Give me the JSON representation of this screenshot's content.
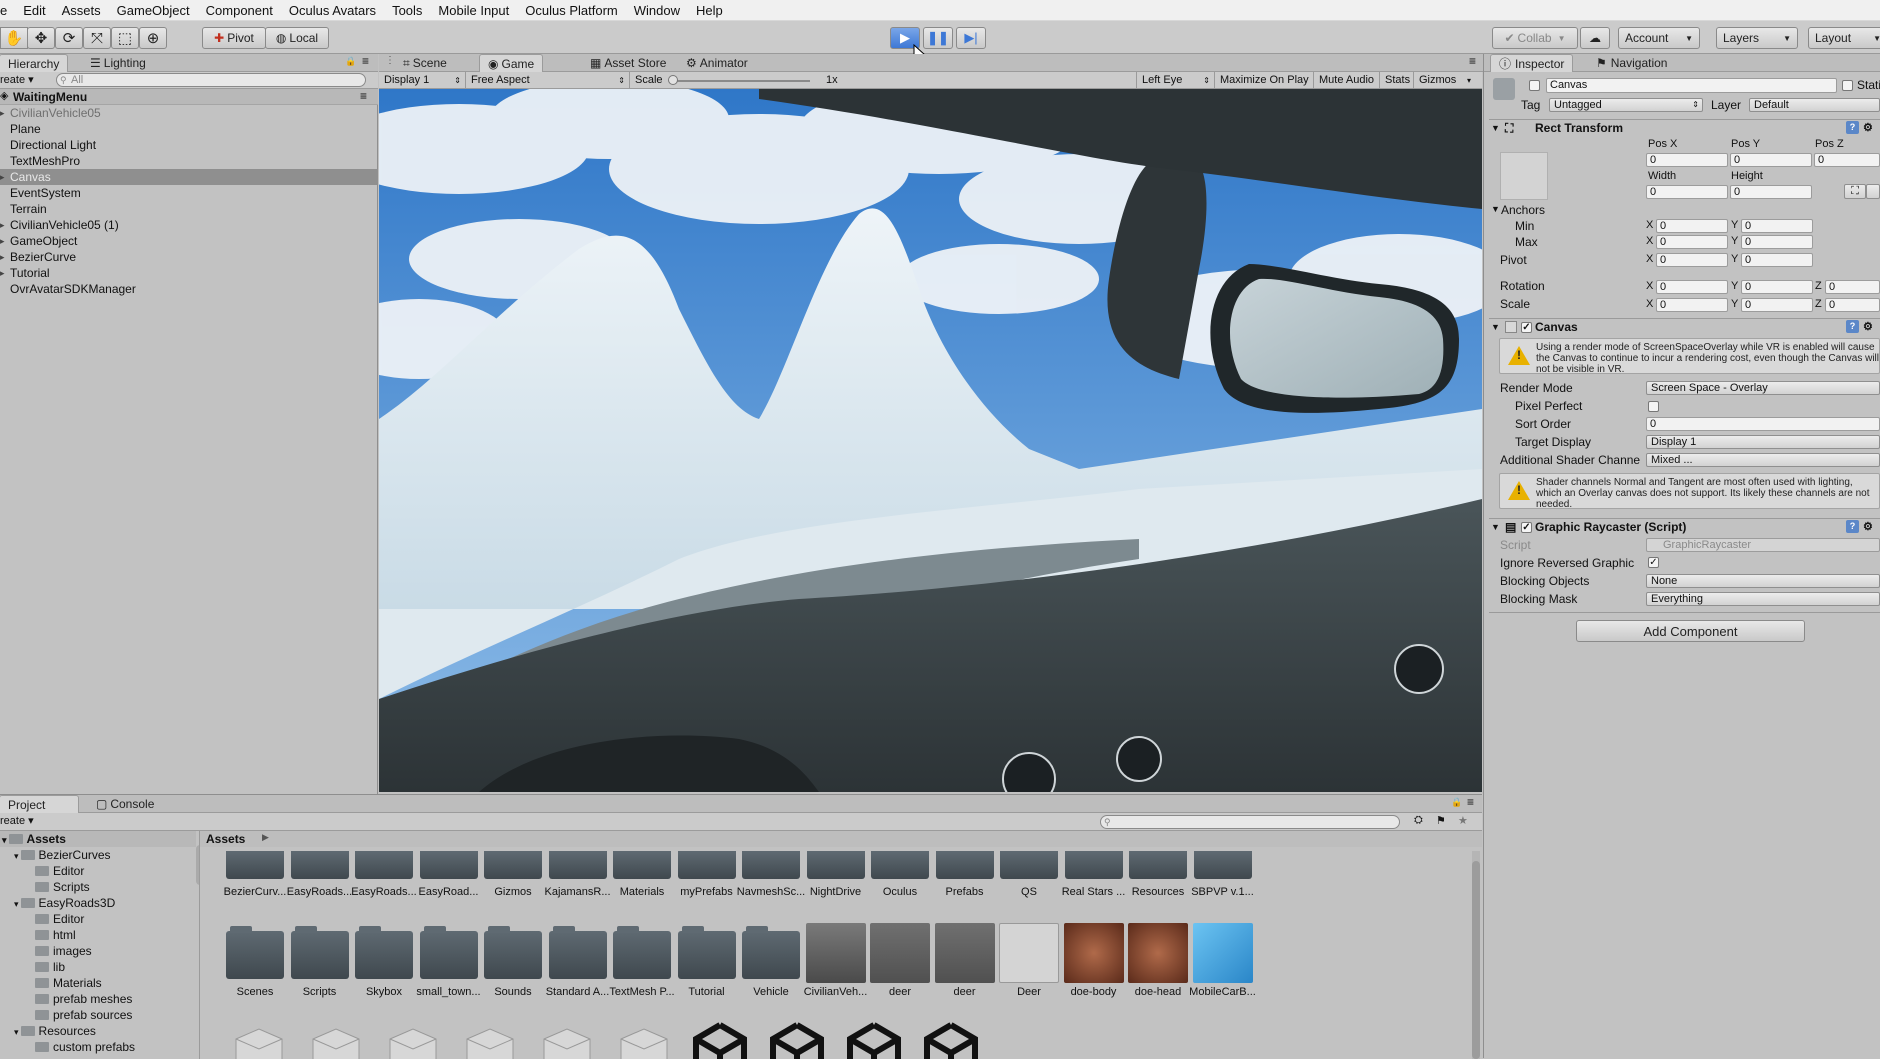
{
  "menu": [
    "e",
    "Edit",
    "Assets",
    "GameObject",
    "Component",
    "Oculus Avatars",
    "Tools",
    "Mobile Input",
    "Oculus Platform",
    "Window",
    "Help"
  ],
  "toolbar": {
    "pivot_label": "Pivot",
    "local_label": "Local",
    "collab_label": "Collab",
    "account_label": "Account",
    "layers_label": "Layers",
    "layout_label": "Layout",
    "play_state": "playing"
  },
  "hierarchy": {
    "tab_label": "Hierarchy",
    "lighting_tab_label": "Lighting",
    "create_label": "reate",
    "search_placeholder": "All",
    "scene_name": "WaitingMenu",
    "items": [
      {
        "label": "CivilianVehicle05",
        "expandable": true,
        "dimmed": true
      },
      {
        "label": "Plane",
        "expandable": false
      },
      {
        "label": "Directional Light",
        "expandable": false
      },
      {
        "label": "TextMeshPro",
        "expandable": false
      },
      {
        "label": "Canvas",
        "expandable": true,
        "selected": true
      },
      {
        "label": "EventSystem",
        "expandable": false
      },
      {
        "label": "Terrain",
        "expandable": false
      },
      {
        "label": "CivilianVehicle05 (1)",
        "expandable": true
      },
      {
        "label": "GameObject",
        "expandable": true
      },
      {
        "label": "BezierCurve",
        "expandable": true
      },
      {
        "label": "Tutorial",
        "expandable": true
      },
      {
        "label": "OvrAvatarSDKManager",
        "expandable": false
      }
    ]
  },
  "center_tabs": {
    "scene": "Scene",
    "game": "Game",
    "asset_store": "Asset Store",
    "animator": "Animator"
  },
  "game_bar": {
    "display": "Display 1",
    "aspect": "Free Aspect",
    "scale_label": "Scale",
    "scale_value": "1x",
    "eye": "Left Eye",
    "maximize": "Maximize On Play",
    "mute": "Mute Audio",
    "stats": "Stats",
    "gizmos": "Gizmos"
  },
  "inspector": {
    "tab_label": "Inspector",
    "navigation_tab_label": "Navigation",
    "object_name": "Canvas",
    "static_label": "Static",
    "tag_label": "Tag",
    "tag_value": "Untagged",
    "layer_label": "Layer",
    "layer_value": "Default",
    "rect_transform": {
      "title": "Rect Transform",
      "pos_x_label": "Pos X",
      "pos_y_label": "Pos Y",
      "pos_z_label": "Pos Z",
      "pos_x": "0",
      "pos_y": "0",
      "pos_z": "0",
      "width_label": "Width",
      "height_label": "Height",
      "width": "0",
      "height": "0",
      "anchors_label": "Anchors",
      "min_label": "Min",
      "max_label": "Max",
      "pivot_label": "Pivot",
      "rotation_label": "Rotation",
      "scale_label": "Scale",
      "min_x": "0",
      "min_y": "0",
      "max_x": "0",
      "max_y": "0",
      "pivot_x": "0",
      "pivot_y": "0",
      "rot_x": "0",
      "rot_y": "0",
      "rot_z": "0",
      "scale_x": "0",
      "scale_y": "0",
      "scale_z": "0",
      "x": "X",
      "y": "Y",
      "z": "Z"
    },
    "canvas": {
      "title": "Canvas",
      "warning": "Using a render mode of ScreenSpaceOverlay while VR is enabled will cause the Canvas to continue to incur a rendering cost, even though the Canvas will not be visible in VR.",
      "render_mode_label": "Render Mode",
      "render_mode_value": "Screen Space - Overlay",
      "pixel_perfect_label": "Pixel Perfect",
      "sort_order_label": "Sort Order",
      "sort_order_value": "0",
      "target_display_label": "Target Display",
      "target_display_value": "Display 1",
      "shader_channels_label": "Additional Shader Channe",
      "shader_channels_value": "Mixed ...",
      "shader_warning": "Shader channels Normal and Tangent are most often used with lighting, which an Overlay canvas does not support. Its likely these channels are not needed."
    },
    "raycaster": {
      "title": "Graphic Raycaster (Script)",
      "script_label": "Script",
      "script_value": "GraphicRaycaster",
      "ignore_reversed_label": "Ignore Reversed Graphic",
      "blocking_objects_label": "Blocking Objects",
      "blocking_objects_value": "None",
      "blocking_mask_label": "Blocking Mask",
      "blocking_mask_value": "Everything"
    },
    "add_component_label": "Add Component"
  },
  "project": {
    "tab_label": "Project",
    "console_tab_label": "Console",
    "create_label": "reate",
    "root_label": "Assets",
    "breadcrumb": "Assets",
    "tree": [
      {
        "label": "Assets",
        "depth": 0,
        "expanded": true,
        "bold": true
      },
      {
        "label": "BezierCurves",
        "depth": 1,
        "expanded": true
      },
      {
        "label": "Editor",
        "depth": 2
      },
      {
        "label": "Scripts",
        "depth": 2
      },
      {
        "label": "EasyRoads3D",
        "depth": 1,
        "expanded": true
      },
      {
        "label": "Editor",
        "depth": 2
      },
      {
        "label": "html",
        "depth": 2
      },
      {
        "label": "images",
        "depth": 2
      },
      {
        "label": "lib",
        "depth": 2
      },
      {
        "label": "Materials",
        "depth": 2
      },
      {
        "label": "prefab meshes",
        "depth": 2
      },
      {
        "label": "prefab sources",
        "depth": 2
      },
      {
        "label": "Resources",
        "depth": 1,
        "expanded": true
      },
      {
        "label": "custom prefabs",
        "depth": 2
      }
    ],
    "row1": [
      "BezierCurv...",
      "EasyRoads...",
      "EasyRoads...",
      "EasyRoad...",
      "Gizmos",
      "KajamansR...",
      "Materials",
      "myPrefabs",
      "NavmeshSc...",
      "NightDrive",
      "Oculus",
      "Prefabs",
      "QS",
      "Real Stars ...",
      "Resources",
      "SBPVP v.1..."
    ],
    "row2_folders": [
      "Scenes",
      "Scripts",
      "Skybox",
      "small_town...",
      "Sounds",
      "Standard A...",
      "TextMesh P...",
      "Tutorial",
      "Vehicle"
    ],
    "row2_assets": [
      {
        "label": "CivilianVeh...",
        "icon": "car-thumbnail"
      },
      {
        "label": "deer",
        "icon": "deer-thumbnail"
      },
      {
        "label": "deer",
        "icon": "deer-thumbnail"
      },
      {
        "label": "Deer",
        "icon": "animator-icon"
      },
      {
        "label": "doe-body",
        "icon": "texture-thumbnail"
      },
      {
        "label": "doe-head",
        "icon": "texture-thumbnail"
      },
      {
        "label": "MobileCarB...",
        "icon": "cube-icon"
      }
    ]
  },
  "colors": {
    "play_active": "#3d78d6",
    "selection": "#8f8f8f",
    "panel_bg": "#c2c2c2",
    "sky": "#3f86d0"
  }
}
